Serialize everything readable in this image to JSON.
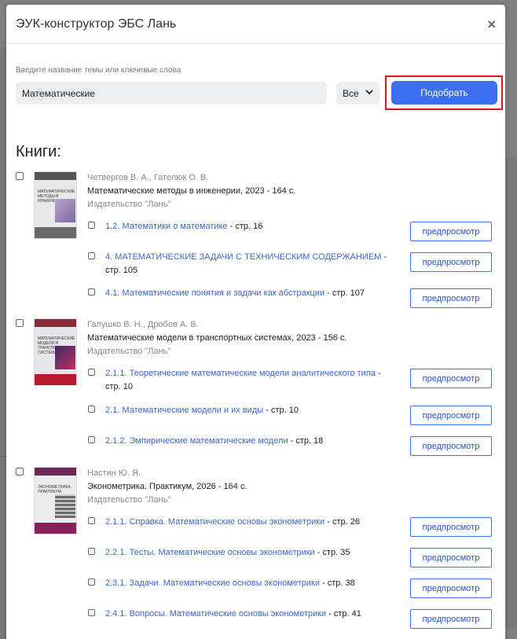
{
  "modal": {
    "title": "ЭУК-конструктор ЭБС Лань",
    "close": "×"
  },
  "search": {
    "label": "Введите название темы или ключевые слова",
    "value": "Математические",
    "scope_value": "Все",
    "submit_label": "Подобрать"
  },
  "books_heading": "Книги:",
  "preview_label": "предпросмотр",
  "colors": {
    "accent": "#3b6ff0",
    "highlight": "#e0161f",
    "link": "#3a66cc"
  },
  "books": [
    {
      "authors": "Четвергов В. А., Гателюк О. В.",
      "title": "Математические методы в инженерии, 2023 - 164 с.",
      "publisher": "Издательство \"Лань\"",
      "cover_text": "Математические методы в инженерии",
      "chapters": [
        {
          "link": "1.2. Математики о математике",
          "suffix": " - стр. 16"
        },
        {
          "link": "4. МАТЕМАТИЧЕСКИЕ ЗАДАЧИ С ТЕХНИЧЕСКИМ СОДЕРЖАНИЕМ",
          "suffix": " - стр. 105"
        },
        {
          "link": "4.1. Математические понятия и задачи как абстракции",
          "suffix": " - стр. 107"
        }
      ]
    },
    {
      "authors": "Галушко В. Н., Дробов А. В.",
      "title": "Математические модели в транспортных системах, 2023 - 156 с.",
      "publisher": "Издательство \"Лань\"",
      "cover_text": "Математические модели в транспортных системах",
      "chapters": [
        {
          "link": "2.1.1. Теоретические математические модели аналитического типа",
          "suffix": " - стр. 10"
        },
        {
          "link": "2.1. Математические модели и их виды",
          "suffix": " - стр. 10"
        },
        {
          "link": "2.1.2. Эмпирические математические модели",
          "suffix": " - стр. 18"
        }
      ]
    },
    {
      "authors": "Настин Ю. Я.",
      "title": "Эконометрика. Практикум, 2026 - 164 с.",
      "publisher": "Издательство \"Лань\"",
      "cover_text": "Эконометрика. Практикум",
      "chapters": [
        {
          "link": "2.1.1. Справка. Математические основы эконометрики",
          "suffix": " - стр. 26"
        },
        {
          "link": "2.2.1. Тесты. Математические основы эконометрики",
          "suffix": " - стр. 35"
        },
        {
          "link": "2.3.1. Задачи. Математические основы эконометрики",
          "suffix": " - стр. 38"
        },
        {
          "link": "2.4.1. Вопросы. Математические основы эконометрики",
          "suffix": " - стр. 41"
        }
      ]
    }
  ]
}
